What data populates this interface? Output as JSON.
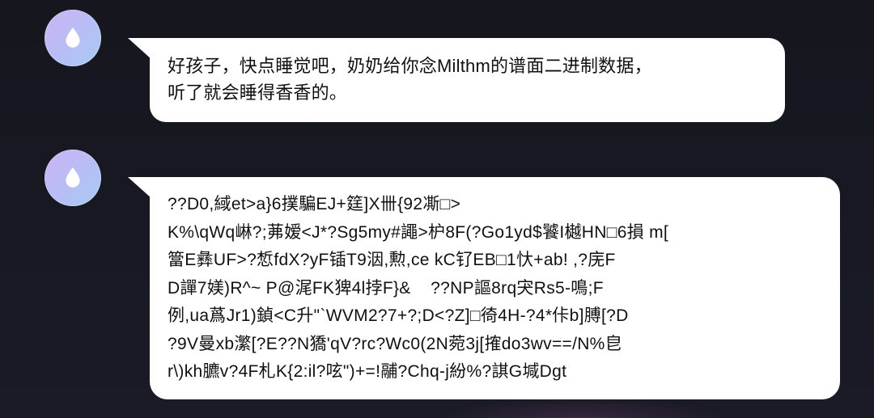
{
  "colors": {
    "background": "#16171f",
    "bubble": "#ffffff",
    "text": "#111111",
    "avatar_gradient_start": "#cdb3f6",
    "avatar_gradient_end": "#a6cbf4",
    "avatar_icon": "#ffffff"
  },
  "messages": [
    {
      "avatar_icon": "droplet-icon",
      "lines": [
        "好孩子，快点睡觉吧，奶奶给你念Milthm的谱面二进制数据，",
        "听了就会睡得香香的。"
      ]
    },
    {
      "avatar_icon": "droplet-icon",
      "lines": [
        "??D0,緎et>a}6撲騙EJ+筳]X卌{92凘□>",
        "K%\\qWq崊?;茀嫒<J*?Sg5my#譝>枦8F(?Go1yd$饕I樾HN□6損 m[",
        "簹E彝UF>?惁fdX?yF锸T9洇,勲,ce kC钌EB□1忕+ab! ,?庑F",
        "D譂7媄)R^~ P@浘FK猈4l挬F}&    ??NP謳8rq宊Rs5-鳴;F",
        "例,ua蔿Jr1)鍞<C升\"`WVM2?7+?;D<?Z]□徛4H-?4*佧b]膊[?D",
        "?9V曼xb瀿[?E??N獢'qV?rc?Wc0(2N菀3j[搉do3wv==/N%皀",
        "r\\)kh臕v?4F札K{2:il?呟\")+=!鬴?Chq-j紛%?諆G堿Dgt"
      ]
    }
  ]
}
